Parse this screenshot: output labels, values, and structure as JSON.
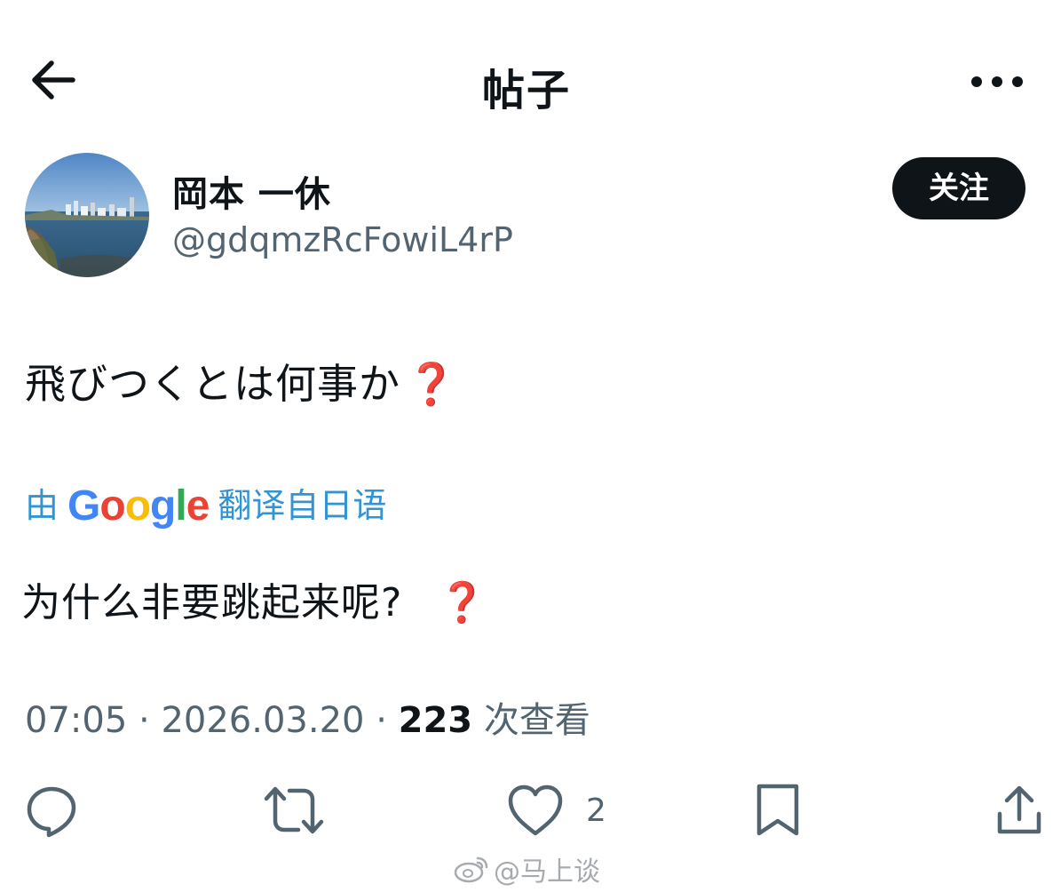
{
  "header": {
    "title": "帖子",
    "back_icon": "arrow-left-icon",
    "more_icon": "more-horizontal-icon"
  },
  "author": {
    "display_name": "岡本 一休",
    "handle": "@gdqmzRcFowiL4rP",
    "follow_label": "关注"
  },
  "post": {
    "text": "飛びつくとは何事か",
    "emoji": "❓"
  },
  "translation": {
    "prefix": "由",
    "brand": "Google",
    "suffix": "翻译自日语",
    "text": "为什么非要跳起来呢?",
    "emoji": "❓"
  },
  "meta": {
    "time": "07:05",
    "separator": "·",
    "date": "2026.03.20",
    "views_count": "223",
    "views_label": "次查看"
  },
  "actions": {
    "reply_icon": "reply-icon",
    "repost_icon": "repost-icon",
    "like_icon": "heart-icon",
    "like_count": "2",
    "bookmark_icon": "bookmark-icon",
    "share_icon": "share-icon"
  },
  "watermark": {
    "text": "@马上谈"
  },
  "colors": {
    "text_primary": "#0f1419",
    "text_secondary": "#536471",
    "link_blue": "#3394d1",
    "question_red": "#d81e2a",
    "google_blue": "#4285F4",
    "google_red": "#EA4335",
    "google_yellow": "#FBBC05",
    "google_green": "#34A853"
  }
}
